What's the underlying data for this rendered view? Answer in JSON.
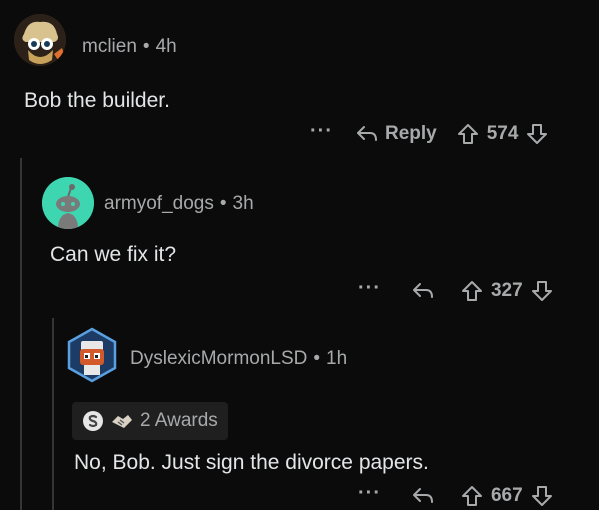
{
  "comments": [
    {
      "username": "mclien",
      "age": "4h",
      "text": "Bob the builder.",
      "reply_label": "Reply",
      "score": "574"
    },
    {
      "username": "armyof_dogs",
      "age": "3h",
      "text": "Can we fix it?",
      "score": "327"
    },
    {
      "username": "DyslexicMormonLSD",
      "age": "1h",
      "awards_label": "2 Awards",
      "text": "No, Bob. Just sign the divorce papers.",
      "score": "667"
    }
  ],
  "icons": {
    "more": "more-options-icon",
    "reply": "reply-arrow-icon",
    "upvote": "upvote-arrow-icon",
    "downvote": "downvote-arrow-icon"
  },
  "colors": {
    "background": "#0b0b0b",
    "text": "#d7dadc",
    "muted": "#a7a9ab",
    "snoo_avatar_bg": "#3ed6b0"
  }
}
